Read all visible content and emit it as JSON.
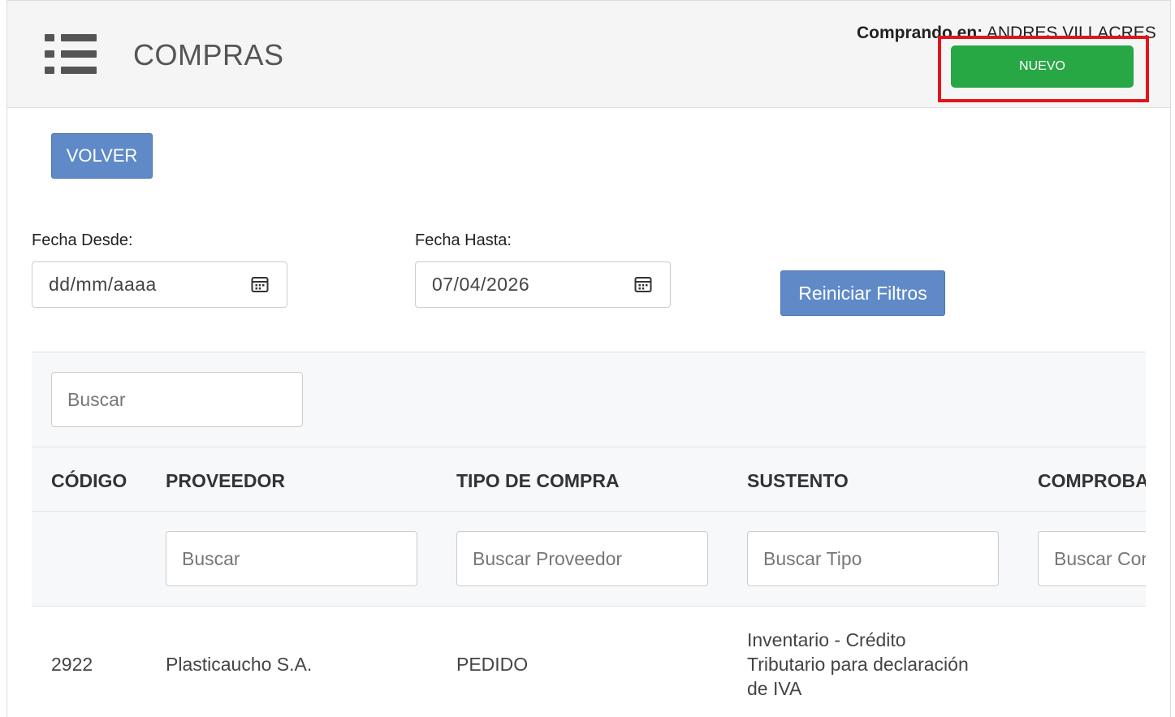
{
  "header": {
    "title": "COMPRAS",
    "buyer_label": "Comprando en:",
    "buyer_name": "ANDRES VILLACRES",
    "new_label": "NUEVO"
  },
  "actions": {
    "back_label": "VOLVER",
    "reset_label": "Reiniciar Filtros"
  },
  "filters": {
    "from_label": "Fecha Desde:",
    "from_value": "dd/mm/aaaa",
    "to_label": "Fecha Hasta:",
    "to_value": "07/04/2026"
  },
  "table": {
    "global_search_placeholder": "Buscar",
    "columns": [
      "CÓDIGO",
      "PROVEEDOR",
      "TIPO DE COMPRA",
      "SUSTENTO",
      "COMPROBA"
    ],
    "column_search_placeholders": [
      "Buscar",
      "Buscar Proveedor",
      "Buscar Tipo",
      "Buscar Con"
    ],
    "rows": [
      {
        "codigo": "2922",
        "proveedor": "Plasticaucho S.A.",
        "tipo": "PEDIDO",
        "sustento_lines": [
          "Inventario - Crédito",
          "Tributario para declaración",
          "de IVA"
        ]
      }
    ]
  },
  "colors": {
    "primary": "#5f8ac7",
    "success": "#28a745",
    "highlight": "#e0151c"
  }
}
